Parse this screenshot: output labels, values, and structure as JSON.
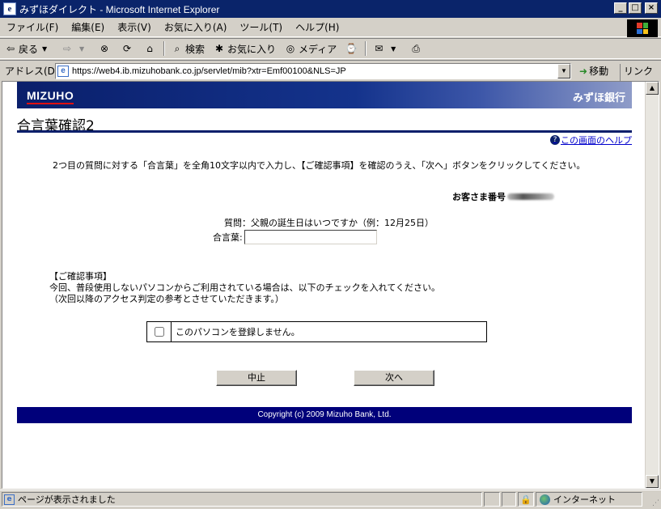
{
  "window": {
    "title": "みずほダイレクト - Microsoft Internet Explorer",
    "controls": [
      "_",
      "□",
      "×"
    ]
  },
  "menu": [
    "ファイル(F)",
    "編集(E)",
    "表示(V)",
    "お気に入り(A)",
    "ツール(T)",
    "ヘルプ(H)"
  ],
  "toolbar": {
    "back": "戻る",
    "search": "検索",
    "favorites": "お気に入り",
    "media": "メディア"
  },
  "address": {
    "label": "アドレス(D)",
    "url": "https://web4.ib.mizuhobank.co.jp/servlet/mib?xtr=Emf00100&NLS=JP",
    "go": "移動",
    "links": "リンク"
  },
  "page": {
    "brand_logo": "MIZUHO",
    "brand_jp": "みずほ銀行",
    "title": "合言葉確認2",
    "help_link": "この画面のヘルプ",
    "instruction": "2つ目の質問に対する「合言葉」を全角10文字以内で入力し、【ご確認事項】を確認のうえ、「次へ」ボタンをクリックしてください。",
    "customer_number_label": "お客さま番号",
    "question": "質問：父親の誕生日はいつですか（例：12月25日）",
    "answer_label": "合言葉:",
    "answer_value": "",
    "confirm_heading": "【ご確認事項】",
    "confirm_line1": "今回、普段使用しないパソコンからご利用されている場合は、以下のチェックを入れてください。",
    "confirm_line2": "（次回以降のアクセス判定の参考とさせていただきます。）",
    "checkbox_label": "このパソコンを登録しません。",
    "checkbox_checked": false,
    "cancel_button": "中止",
    "next_button": "次へ",
    "copyright": "Copyright (c) 2009 Mizuho Bank, Ltd."
  },
  "status": {
    "text": "ページが表示されました",
    "zone": "インターネット"
  }
}
